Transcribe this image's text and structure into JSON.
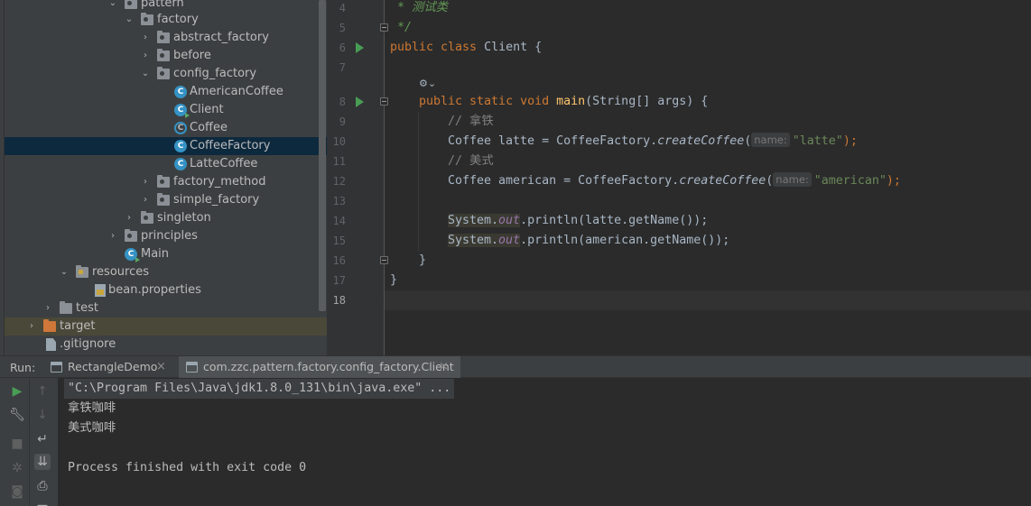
{
  "project_tree": {
    "items": [
      {
        "label": "pattern",
        "kind": "package"
      },
      {
        "label": "factory",
        "kind": "package"
      },
      {
        "label": "abstract_factory",
        "kind": "package"
      },
      {
        "label": "before",
        "kind": "package"
      },
      {
        "label": "config_factory",
        "kind": "package"
      },
      {
        "label": "AmericanCoffee",
        "kind": "class",
        "badge": "C"
      },
      {
        "label": "Client",
        "kind": "class",
        "badge": "C"
      },
      {
        "label": "Coffee",
        "kind": "abstract-class",
        "badge": "C"
      },
      {
        "label": "CoffeeFactory",
        "kind": "class",
        "badge": "C"
      },
      {
        "label": "LatteCoffee",
        "kind": "class",
        "badge": "C"
      },
      {
        "label": "factory_method",
        "kind": "package"
      },
      {
        "label": "simple_factory",
        "kind": "package"
      },
      {
        "label": "singleton",
        "kind": "package"
      },
      {
        "label": "principles",
        "kind": "package"
      },
      {
        "label": "Main",
        "kind": "class",
        "badge": "C"
      },
      {
        "label": "resources",
        "kind": "resources-folder"
      },
      {
        "label": "bean.properties",
        "kind": "properties-file"
      },
      {
        "label": "test",
        "kind": "folder"
      },
      {
        "label": "target",
        "kind": "excluded-folder"
      },
      {
        "label": ".gitignore",
        "kind": "file"
      }
    ],
    "selected": "CoffeeFactory"
  },
  "editor": {
    "line_numbers": [
      "4",
      "5",
      "6",
      "7",
      "8",
      "9",
      "10",
      "11",
      "12",
      "13",
      "14",
      "15",
      "16",
      "17",
      "18"
    ],
    "current_line": "18",
    "code": {
      "l4_doc": " * 测试类",
      "l5_doc": " */",
      "l6_kw": "public class",
      "l6_rest": " Client {",
      "l8_kw": "public static void",
      "l8_fn": "main",
      "l8_rest": "(String[] args) {",
      "l9_comment": "// 拿铁",
      "l10_a": "Coffee latte = CoffeeFactory.",
      "l10_method": "createCoffee",
      "l10_paren": "(",
      "l10_hint": "name:",
      "l10_str": "\"latte\"",
      "l10_end": ");",
      "l11_comment": "// 美式",
      "l12_a": "Coffee american = CoffeeFactory.",
      "l12_method": "createCoffee",
      "l12_paren": "(",
      "l12_hint": "name:",
      "l12_str": "\"american\"",
      "l12_end": ");",
      "l14_sys": "System.",
      "l14_out": "out",
      "l14_rest": ".println(latte.getName());",
      "l15_sys": "System.",
      "l15_out": "out",
      "l15_rest": ".println(american.getName());",
      "l16": "}",
      "l17": "}"
    }
  },
  "run_panel": {
    "label": "Run:",
    "tabs": [
      {
        "label": "RectangleDemo",
        "active": false
      },
      {
        "label": "com.zzc.pattern.factory.config_factory.Client",
        "active": true
      }
    ],
    "close_glyph": "×",
    "console": {
      "command": "\"C:\\Program Files\\Java\\jdk1.8.0_131\\bin\\java.exe\" ...",
      "lines": [
        "拿铁咖啡",
        "美式咖啡"
      ],
      "finished": "Process finished with exit code 0"
    }
  },
  "colors": {
    "keyword": "#cc7832",
    "method": "#ffc66d",
    "string": "#6a8759",
    "doc_comment": "#629755",
    "static_field": "#9876aa",
    "selection": "#0d293e",
    "run_green": "#499c54"
  }
}
